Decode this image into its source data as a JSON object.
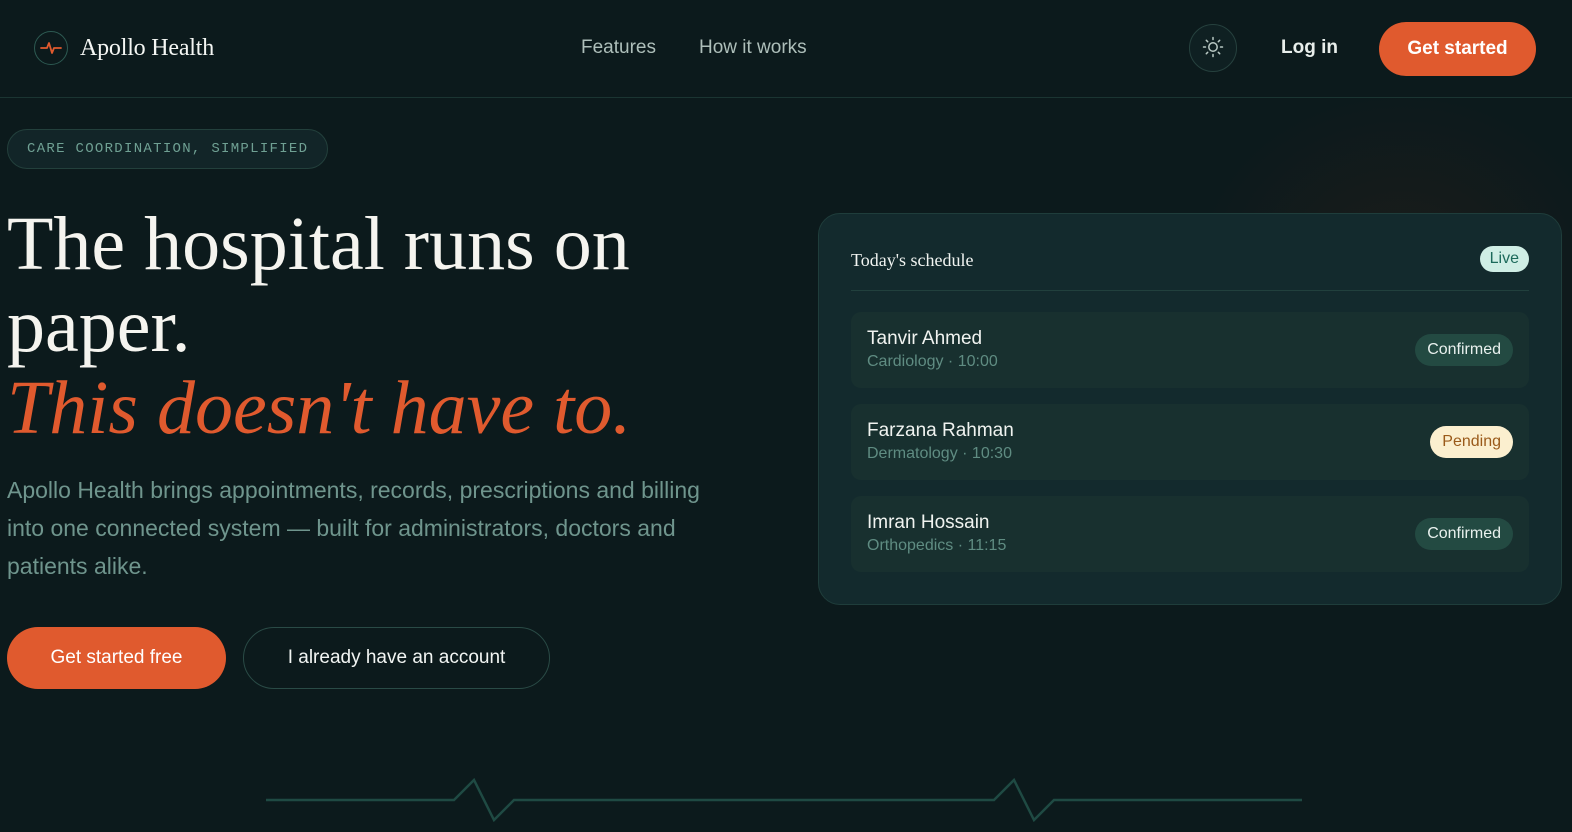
{
  "brand": {
    "name": "Apollo Health",
    "icon": "pulse-icon",
    "accent": "#e05a2e"
  },
  "nav": {
    "links": [
      {
        "label": "Features"
      },
      {
        "label": "How it works"
      }
    ],
    "theme_icon": "sun-icon",
    "login_label": "Log in",
    "cta_label": "Get started"
  },
  "hero": {
    "eyebrow": "CARE COORDINATION, SIMPLIFIED",
    "headline": "The hospital runs on paper.",
    "headline_accent": "This doesn't have to.",
    "lede": "Apollo Health brings appointments, records, prescriptions and billing into one connected system — built for administrators, doctors and patients alike.",
    "primary_cta": "Get started free",
    "secondary_cta": "I already have an account"
  },
  "schedule": {
    "title": "Today's schedule",
    "status": "Live",
    "appointments": [
      {
        "name": "Tanvir Ahmed",
        "detail": "Cardiology · 10:00",
        "status": "Confirmed"
      },
      {
        "name": "Farzana Rahman",
        "detail": "Dermatology · 10:30",
        "status": "Pending"
      },
      {
        "name": "Imran Hossain",
        "detail": "Orthopedics · 11:15",
        "status": "Confirmed"
      }
    ]
  },
  "colors": {
    "background": "#0c1a1c",
    "accent": "#e05a2e",
    "confirmed_badge": "#234a42",
    "pending_badge": "#fbefcf",
    "live_badge": "#cfeee5"
  }
}
